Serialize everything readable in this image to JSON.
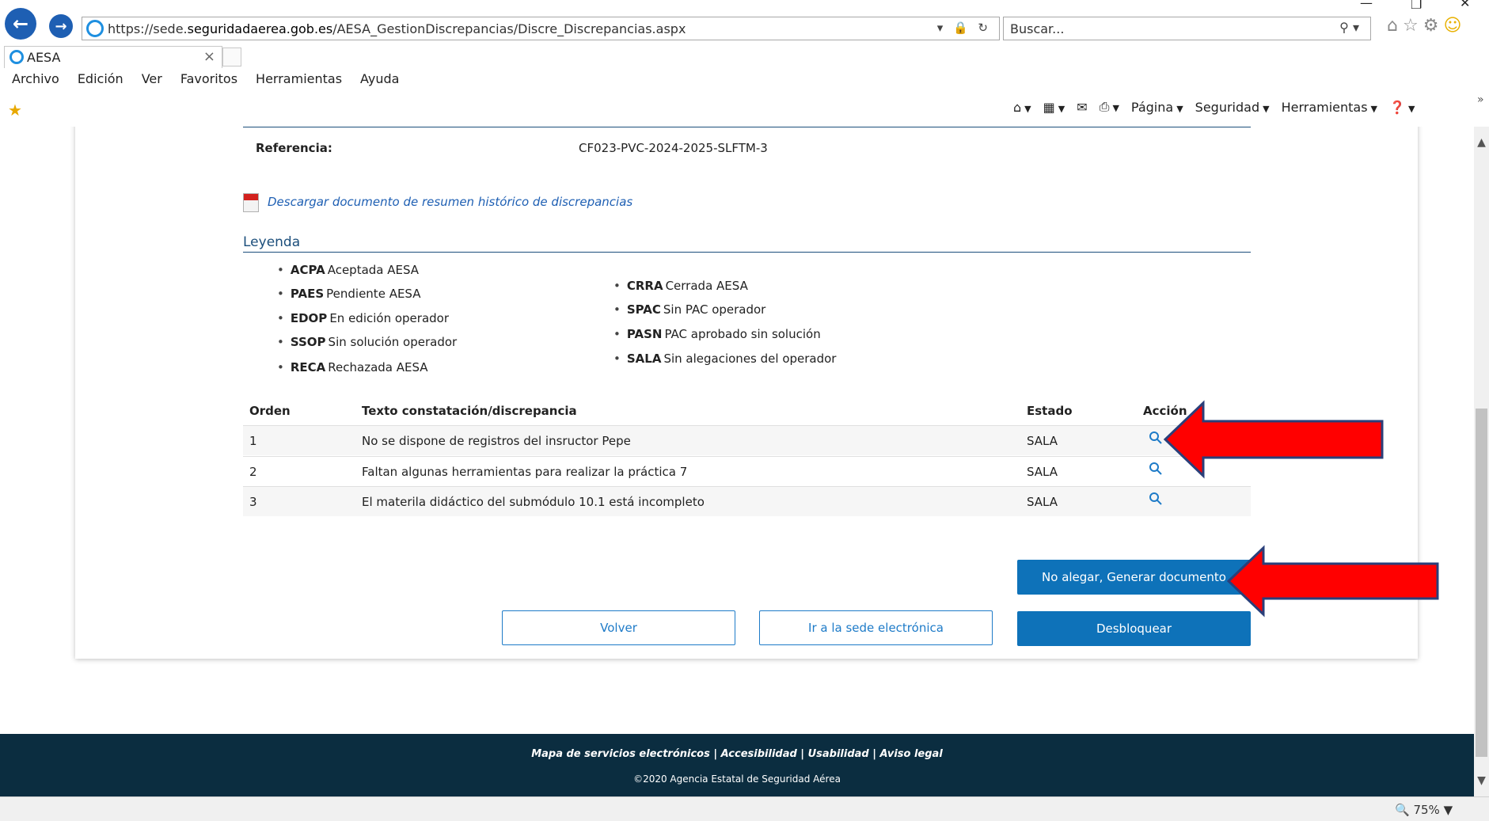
{
  "browser": {
    "url_prefix": "https://sede.",
    "url_domain": "seguridadaerea.gob.es",
    "url_path": "/AESA_GestionDiscrepancias/Discre_Discrepancias.aspx",
    "search_placeholder": "Buscar...",
    "tab_title": "AESA",
    "menu": [
      "Archivo",
      "Edición",
      "Ver",
      "Favoritos",
      "Herramientas",
      "Ayuda"
    ],
    "command_bar": {
      "pagina": "Página",
      "seguridad": "Seguridad",
      "herramientas": "Herramientas"
    },
    "zoom": "75%"
  },
  "page": {
    "referencia_label": "Referencia:",
    "referencia_value": "CF023-PVC-2024-2025-SLFTM-3",
    "download_link": "Descargar documento de resumen histórico de discrepancias",
    "legend_title": "Leyenda",
    "legend_left": [
      {
        "code": "ACPA",
        "text": "Aceptada AESA"
      },
      {
        "code": "PAES",
        "text": "Pendiente AESA"
      },
      {
        "code": "EDOP",
        "text": "En edición operador"
      },
      {
        "code": "SSOP",
        "text": "Sin solución operador"
      },
      {
        "code": "RECA",
        "text": "Rechazada AESA"
      }
    ],
    "legend_right": [
      {
        "code": "CRRA",
        "text": "Cerrada AESA"
      },
      {
        "code": "SPAC",
        "text": "Sin PAC operador"
      },
      {
        "code": "PASN",
        "text": "PAC aprobado sin solución"
      },
      {
        "code": "SALA",
        "text": "Sin alegaciones del operador"
      }
    ],
    "table": {
      "headers": {
        "orden": "Orden",
        "texto": "Texto constatación/discrepancia",
        "estado": "Estado",
        "accion": "Acción"
      },
      "rows": [
        {
          "orden": "1",
          "texto": "No se dispone de registros del insructor Pepe",
          "estado": "SALA"
        },
        {
          "orden": "2",
          "texto": "Faltan algunas herramientas para realizar la práctica 7",
          "estado": "SALA"
        },
        {
          "orden": "3",
          "texto": "El materila didáctico del submódulo 10.1 está incompleto",
          "estado": "SALA"
        }
      ]
    },
    "buttons": {
      "no_alegar": "No alegar, Generar documento",
      "volver": "Volver",
      "sede": "Ir a la sede electrónica",
      "desbloquear": "Desbloquear"
    },
    "annotation_color": "#ff0000"
  },
  "footer": {
    "links": "Mapa de servicios electrónicos | Accesibilidad | Usabilidad | Aviso legal",
    "copyright": "©2020 Agencia Estatal de Seguridad Aérea"
  }
}
